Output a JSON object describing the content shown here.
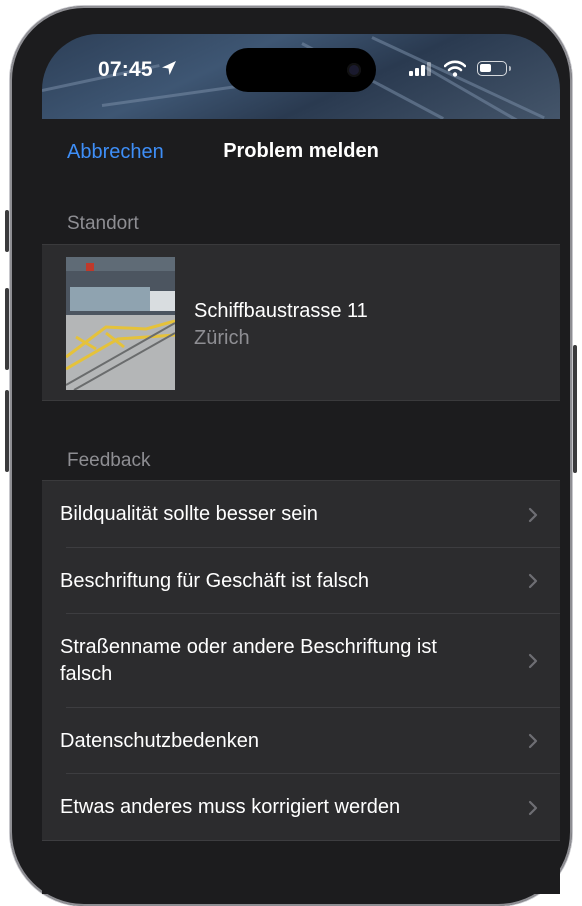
{
  "status_bar": {
    "time": "07:45",
    "icons": [
      "location-arrow-icon",
      "cellular-signal-icon",
      "wifi-icon",
      "battery-icon"
    ]
  },
  "header": {
    "cancel_label": "Abbrechen",
    "title": "Problem melden"
  },
  "location_section": {
    "header": "Standort",
    "street": "Schiffbaustrasse 11",
    "city": "Zürich"
  },
  "feedback_section": {
    "header": "Feedback",
    "items": [
      {
        "label": "Bildqualität sollte besser sein"
      },
      {
        "label": "Beschriftung für Geschäft ist falsch"
      },
      {
        "label": "Straßenname oder andere Beschriftung ist falsch"
      },
      {
        "label": "Datenschutzbedenken"
      },
      {
        "label": "Etwas anderes muss korrigiert werden"
      }
    ]
  },
  "colors": {
    "accent": "#3e8ef7",
    "sheet_background": "#1c1c1e",
    "cell_background": "#2c2c2e",
    "secondary_text": "#8e8e93"
  }
}
